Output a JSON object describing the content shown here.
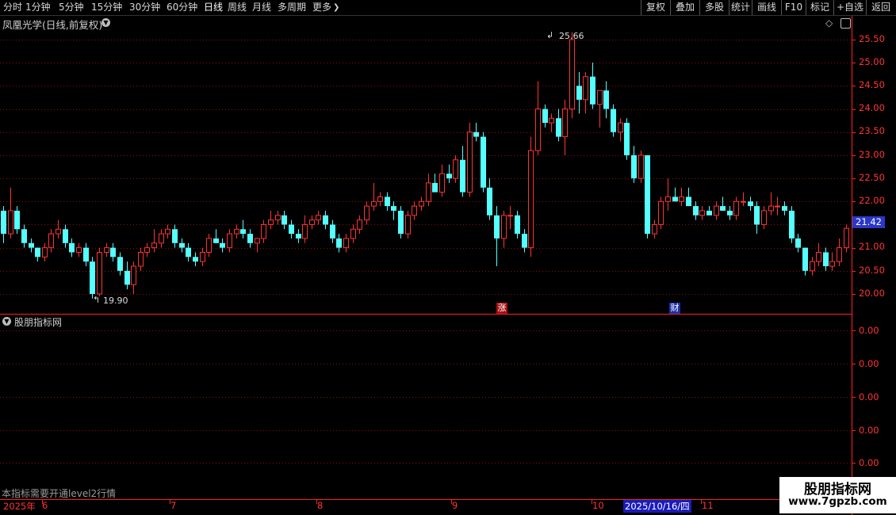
{
  "toolbar": {
    "periods": [
      "分时",
      "1分钟",
      "5分钟",
      "15分钟",
      "30分钟",
      "60分钟",
      "日线",
      "周线",
      "月线",
      "多周期",
      "更多"
    ],
    "active_period": "日线",
    "right_buttons": [
      "复权",
      "叠加",
      "多股",
      "统计",
      "画线",
      "F10",
      "标记",
      "+自选",
      "返回"
    ]
  },
  "stock": {
    "title": "凤凰光学(日线,前复权)",
    "current_price": "21.42"
  },
  "indicator": {
    "title": "股朋指标网",
    "notice": "本指标需要开通level2行情",
    "axis_labels": [
      "0.00",
      "0.00",
      "0.00",
      "0.00",
      "0.00"
    ]
  },
  "markers": {
    "high_label": "25.66",
    "low_label": "19.90",
    "flag_rise": "涨",
    "flag_finance": "财"
  },
  "date_axis": {
    "labels": [
      "2025年",
      "6",
      "7",
      "8",
      "9",
      "10",
      "2025/10/16/四",
      "11"
    ]
  },
  "watermark": {
    "line1": "股朋指标网",
    "line2": "www.7gpzb.com"
  },
  "colors": {
    "up": "#ff3333",
    "down": "#54ffff",
    "grid": "#8a1010",
    "axis": "#ff2020",
    "price_tag": "#2a37c8"
  },
  "chart_data": {
    "type": "candlestick",
    "y_axis_labels": [
      "25.50",
      "25.00",
      "24.50",
      "24.00",
      "23.50",
      "23.00",
      "22.50",
      "22.00",
      "21.50",
      "21.00",
      "20.50",
      "20.00"
    ],
    "ylim": [
      19.7,
      26.1
    ],
    "date_labels": [
      "2025年",
      "6",
      "7",
      "8",
      "9",
      "10",
      "2025/10/16/四",
      "11"
    ],
    "high": 25.66,
    "low": 19.9,
    "last": 21.42,
    "candles": [
      [
        21.8,
        21.9,
        21.1,
        21.3
      ],
      [
        21.3,
        22.3,
        21.2,
        21.8
      ],
      [
        21.8,
        21.9,
        21.3,
        21.4
      ],
      [
        21.4,
        21.5,
        21.0,
        21.1
      ],
      [
        21.1,
        21.2,
        20.9,
        21.0
      ],
      [
        21.0,
        21.0,
        20.7,
        20.8
      ],
      [
        20.8,
        21.1,
        20.7,
        21.0
      ],
      [
        21.0,
        21.4,
        20.9,
        21.3
      ],
      [
        21.3,
        21.6,
        21.2,
        21.4
      ],
      [
        21.4,
        21.5,
        21.0,
        21.1
      ],
      [
        21.1,
        21.2,
        20.8,
        20.9
      ],
      [
        20.9,
        21.1,
        20.8,
        21.0
      ],
      [
        21.0,
        21.1,
        20.6,
        20.7
      ],
      [
        20.7,
        20.8,
        19.9,
        20.0
      ],
      [
        20.0,
        21.0,
        19.95,
        20.9
      ],
      [
        20.9,
        21.1,
        20.8,
        21.0
      ],
      [
        21.0,
        21.1,
        20.7,
        20.8
      ],
      [
        20.8,
        20.9,
        20.4,
        20.5
      ],
      [
        20.5,
        20.7,
        20.1,
        20.2
      ],
      [
        20.2,
        20.7,
        20.0,
        20.6
      ],
      [
        20.6,
        21.0,
        20.5,
        20.9
      ],
      [
        20.9,
        21.1,
        20.8,
        21.0
      ],
      [
        21.0,
        21.4,
        20.9,
        21.1
      ],
      [
        21.1,
        21.4,
        21.0,
        21.3
      ],
      [
        21.3,
        21.5,
        21.2,
        21.4
      ],
      [
        21.4,
        21.5,
        21.0,
        21.1
      ],
      [
        21.1,
        21.2,
        20.9,
        21.0
      ],
      [
        21.0,
        21.1,
        20.7,
        20.8
      ],
      [
        20.8,
        20.9,
        20.6,
        20.7
      ],
      [
        20.7,
        21.0,
        20.6,
        20.9
      ],
      [
        20.9,
        21.3,
        20.8,
        21.2
      ],
      [
        21.2,
        21.4,
        21.1,
        21.1
      ],
      [
        21.1,
        21.2,
        20.9,
        21.0
      ],
      [
        21.0,
        21.4,
        20.9,
        21.3
      ],
      [
        21.3,
        21.5,
        21.2,
        21.4
      ],
      [
        21.4,
        21.6,
        21.2,
        21.3
      ],
      [
        21.3,
        21.4,
        21.0,
        21.1
      ],
      [
        21.1,
        21.2,
        20.9,
        21.2
      ],
      [
        21.2,
        21.6,
        21.1,
        21.5
      ],
      [
        21.5,
        21.8,
        21.4,
        21.6
      ],
      [
        21.6,
        21.8,
        21.5,
        21.7
      ],
      [
        21.7,
        21.8,
        21.4,
        21.5
      ],
      [
        21.5,
        21.6,
        21.2,
        21.3
      ],
      [
        21.3,
        21.4,
        21.1,
        21.2
      ],
      [
        21.2,
        21.7,
        21.1,
        21.5
      ],
      [
        21.5,
        21.7,
        21.4,
        21.6
      ],
      [
        21.6,
        21.8,
        21.5,
        21.7
      ],
      [
        21.7,
        21.8,
        21.4,
        21.5
      ],
      [
        21.5,
        21.6,
        21.1,
        21.2
      ],
      [
        21.2,
        21.3,
        20.9,
        21.0
      ],
      [
        21.0,
        21.3,
        20.9,
        21.2
      ],
      [
        21.2,
        21.5,
        21.1,
        21.4
      ],
      [
        21.4,
        21.7,
        21.3,
        21.6
      ],
      [
        21.6,
        22.0,
        21.5,
        21.9
      ],
      [
        21.9,
        22.4,
        21.8,
        22.0
      ],
      [
        22.0,
        22.2,
        21.9,
        22.1
      ],
      [
        22.1,
        22.2,
        21.8,
        21.9
      ],
      [
        21.9,
        22.0,
        21.6,
        21.8
      ],
      [
        21.8,
        21.9,
        21.2,
        21.3
      ],
      [
        21.3,
        21.8,
        21.2,
        21.7
      ],
      [
        21.7,
        22.0,
        21.6,
        21.9
      ],
      [
        21.9,
        22.1,
        21.8,
        22.0
      ],
      [
        22.0,
        22.6,
        21.9,
        22.4
      ],
      [
        22.4,
        22.6,
        22.2,
        22.2
      ],
      [
        22.2,
        22.8,
        22.1,
        22.6
      ],
      [
        22.6,
        22.8,
        22.4,
        22.5
      ],
      [
        22.5,
        23.0,
        22.4,
        22.9
      ],
      [
        22.9,
        23.2,
        22.1,
        22.2
      ],
      [
        22.2,
        23.7,
        22.1,
        23.5
      ],
      [
        23.5,
        23.7,
        23.3,
        23.4
      ],
      [
        23.4,
        23.5,
        22.2,
        22.3
      ],
      [
        22.3,
        22.5,
        21.6,
        21.7
      ],
      [
        21.7,
        21.9,
        20.6,
        21.2
      ],
      [
        21.2,
        21.8,
        21.0,
        21.7
      ],
      [
        21.7,
        21.9,
        21.4,
        21.7
      ],
      [
        21.7,
        21.8,
        21.2,
        21.3
      ],
      [
        21.3,
        21.4,
        20.9,
        21.0
      ],
      [
        21.0,
        23.4,
        20.8,
        23.1
      ],
      [
        23.1,
        24.6,
        23.0,
        24.0
      ],
      [
        24.0,
        24.1,
        23.6,
        23.7
      ],
      [
        23.7,
        23.9,
        23.5,
        23.8
      ],
      [
        23.8,
        24.0,
        23.3,
        23.4
      ],
      [
        23.4,
        24.2,
        23.0,
        24.0
      ],
      [
        24.0,
        25.66,
        23.8,
        25.5
      ],
      [
        24.5,
        24.8,
        23.9,
        24.2
      ],
      [
        24.2,
        24.8,
        23.9,
        24.7
      ],
      [
        24.7,
        25.0,
        24.0,
        24.1
      ],
      [
        24.1,
        24.3,
        23.6,
        24.4
      ],
      [
        24.4,
        24.6,
        23.8,
        24.0
      ],
      [
        24.0,
        24.1,
        23.4,
        23.5
      ],
      [
        23.5,
        23.8,
        23.3,
        23.7
      ],
      [
        23.7,
        23.8,
        22.9,
        23.0
      ],
      [
        23.0,
        23.2,
        22.4,
        22.5
      ],
      [
        22.5,
        23.1,
        22.4,
        23.0
      ],
      [
        23.0,
        23.0,
        21.2,
        21.3
      ],
      [
        21.3,
        21.6,
        21.2,
        21.5
      ],
      [
        21.5,
        22.1,
        21.4,
        22.0
      ],
      [
        22.0,
        22.5,
        21.8,
        22.1
      ],
      [
        22.1,
        22.3,
        22.0,
        22.0
      ],
      [
        22.0,
        22.3,
        21.9,
        22.1
      ],
      [
        22.1,
        22.3,
        21.9,
        21.9
      ],
      [
        21.9,
        22.0,
        21.6,
        21.7
      ],
      [
        21.7,
        21.9,
        21.6,
        21.8
      ],
      [
        21.8,
        21.9,
        21.7,
        21.7
      ],
      [
        21.7,
        22.0,
        21.6,
        21.9
      ],
      [
        21.9,
        22.1,
        21.8,
        21.8
      ],
      [
        21.8,
        21.9,
        21.6,
        21.7
      ],
      [
        21.7,
        22.1,
        21.6,
        22.0
      ],
      [
        22.0,
        22.2,
        21.9,
        22.0
      ],
      [
        22.0,
        22.1,
        21.8,
        21.9
      ],
      [
        21.9,
        22.0,
        21.3,
        21.5
      ],
      [
        21.5,
        21.9,
        21.4,
        21.8
      ],
      [
        21.8,
        22.2,
        21.7,
        21.9
      ],
      [
        21.9,
        22.1,
        21.7,
        21.9
      ],
      [
        21.9,
        22.0,
        21.7,
        21.8
      ],
      [
        21.8,
        21.9,
        21.1,
        21.2
      ],
      [
        21.2,
        21.3,
        20.9,
        21.0
      ],
      [
        21.0,
        21.0,
        20.4,
        20.5
      ],
      [
        20.5,
        20.8,
        20.4,
        20.7
      ],
      [
        20.7,
        21.1,
        20.6,
        20.9
      ],
      [
        20.9,
        21.0,
        20.5,
        20.6
      ],
      [
        20.6,
        20.9,
        20.5,
        20.7
      ],
      [
        20.7,
        21.2,
        20.6,
        21.0
      ],
      [
        21.0,
        21.5,
        20.9,
        21.42
      ]
    ]
  }
}
